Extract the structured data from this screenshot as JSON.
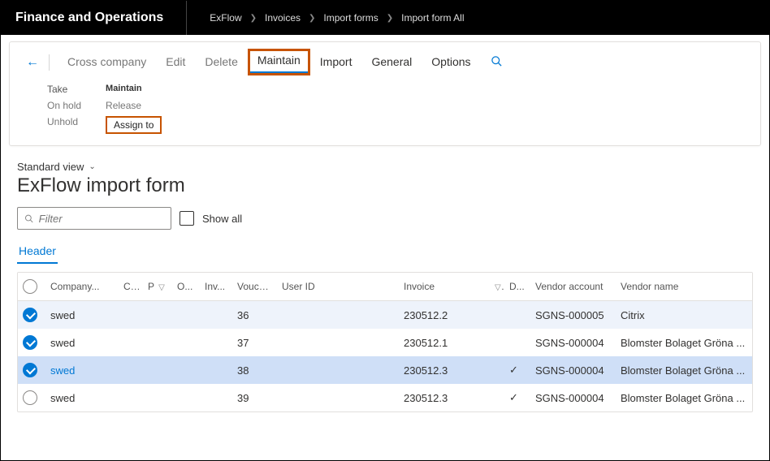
{
  "header": {
    "app_title": "Finance and Operations",
    "breadcrumbs": [
      "ExFlow",
      "Invoices",
      "Import forms",
      "Import form All"
    ]
  },
  "toolbar": {
    "tabs": {
      "cross_company": "Cross company",
      "edit": "Edit",
      "delete": "Delete",
      "maintain": "Maintain",
      "import": "Import",
      "general": "General",
      "options": "Options"
    },
    "maintain_panel": {
      "heading": "Maintain",
      "col1_label": "Take",
      "on_hold": "On hold",
      "unhold": "Unhold",
      "release": "Release",
      "assign_to": "Assign to"
    }
  },
  "page": {
    "view_label": "Standard view",
    "title": "ExFlow import form",
    "filter_placeholder": "Filter",
    "show_all": "Show all",
    "header_tab": "Header"
  },
  "grid": {
    "columns": {
      "company": "Company...",
      "c": "C...",
      "p": "P",
      "o": "O...",
      "inv": "Inv...",
      "voucher": "Voucher",
      "user_id": "User ID",
      "invoice": "Invoice",
      "d": "D...",
      "vendor_account": "Vendor account",
      "vendor_name": "Vendor name"
    },
    "rows": [
      {
        "checked": true,
        "company": "swed",
        "voucher": "36",
        "invoice": "230512.2",
        "d": false,
        "vendor_account": "SGNS-000005",
        "vendor_name": "Citrix",
        "cls": "row-blue"
      },
      {
        "checked": true,
        "company": "swed",
        "voucher": "37",
        "invoice": "230512.1",
        "d": false,
        "vendor_account": "SGNS-000004",
        "vendor_name": "Blomster Bolaget Gröna ...",
        "cls": ""
      },
      {
        "checked": true,
        "company": "swed",
        "voucher": "38",
        "invoice": "230512.3",
        "d": true,
        "vendor_account": "SGNS-000004",
        "vendor_name": "Blomster Bolaget Gröna ...",
        "cls": "row-sel"
      },
      {
        "checked": false,
        "company": "swed",
        "voucher": "39",
        "invoice": "230512.3",
        "d": true,
        "vendor_account": "SGNS-000004",
        "vendor_name": "Blomster Bolaget Gröna ...",
        "cls": ""
      }
    ]
  }
}
